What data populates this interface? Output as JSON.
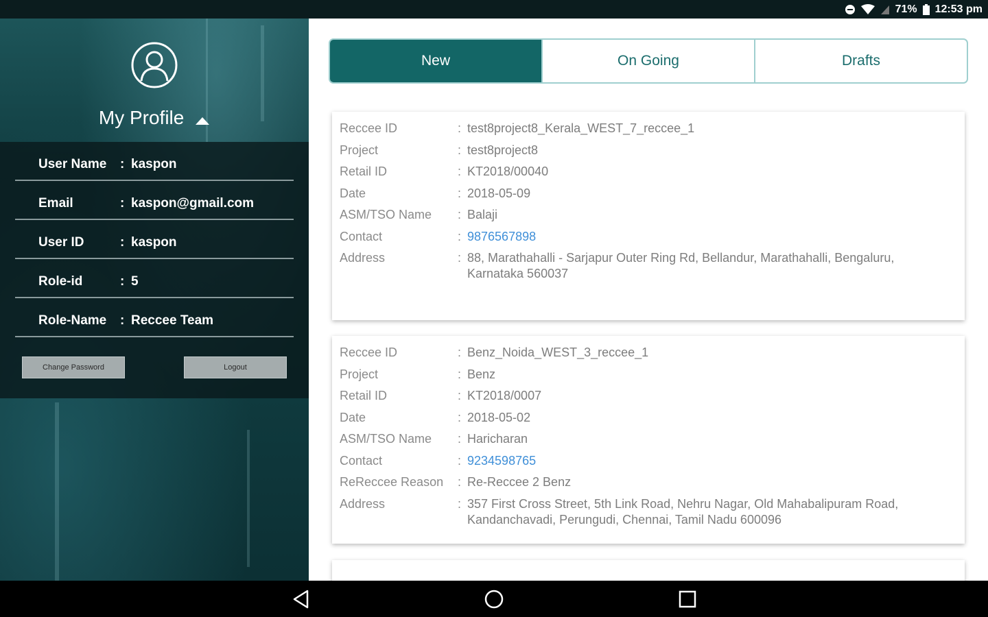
{
  "status_bar": {
    "battery_percent": "71%",
    "time": "12:53 pm",
    "icons": [
      "sync-icon",
      "wifi-icon",
      "signal-icon",
      "battery-icon"
    ]
  },
  "profile": {
    "title": "My Profile",
    "fields": [
      {
        "label": "User Name",
        "value": "kaspon"
      },
      {
        "label": "Email",
        "value": "kaspon@gmail.com"
      },
      {
        "label": "User ID",
        "value": "kaspon"
      },
      {
        "label": "Role-id",
        "value": "5"
      },
      {
        "label": "Role-Name",
        "value": "Reccee Team"
      }
    ],
    "change_password_label": "Change Password",
    "logout_label": "Logout"
  },
  "tabs": [
    {
      "label": "New",
      "active": true
    },
    {
      "label": "On Going",
      "active": false
    },
    {
      "label": "Drafts",
      "active": false
    }
  ],
  "cards": [
    {
      "fields": [
        {
          "label": "Reccee ID",
          "value": "test8project8_Kerala_WEST_7_reccee_1"
        },
        {
          "label": "Project",
          "value": "test8project8"
        },
        {
          "label": "Retail ID",
          "value": "KT2018/00040"
        },
        {
          "label": "Date",
          "value": "2018-05-09"
        },
        {
          "label": "ASM/TSO Name",
          "value": "Balaji"
        },
        {
          "label": "Contact",
          "value": "9876567898"
        },
        {
          "label": "Address",
          "value": "88, Marathahalli - Sarjapur Outer Ring Rd, Bellandur, Marathahalli, Bengaluru, Karnataka 560037"
        }
      ]
    },
    {
      "fields": [
        {
          "label": "Reccee ID",
          "value": "Benz_Noida_WEST_3_reccee_1"
        },
        {
          "label": "Project",
          "value": "Benz"
        },
        {
          "label": "Retail ID",
          "value": "KT2018/0007"
        },
        {
          "label": "Date",
          "value": "2018-05-02"
        },
        {
          "label": "ASM/TSO Name",
          "value": "Haricharan"
        },
        {
          "label": "Contact",
          "value": "9234598765"
        },
        {
          "label": "ReReccee Reason",
          "value": "Re-Reccee 2 Benz"
        },
        {
          "label": "Address",
          "value": "357 First Cross Street, 5th Link Road, Nehru Nagar, Old Mahabalipuram Road, Kandanchavadi, Perungudi, Chennai, Tamil Nadu  600096"
        }
      ]
    }
  ],
  "colors": {
    "accent": "#136666",
    "tab_border": "#9fcfcf",
    "link": "#3f8fd8"
  },
  "nav_bar": {
    "icons": [
      "back-icon",
      "home-icon",
      "recents-icon"
    ]
  }
}
